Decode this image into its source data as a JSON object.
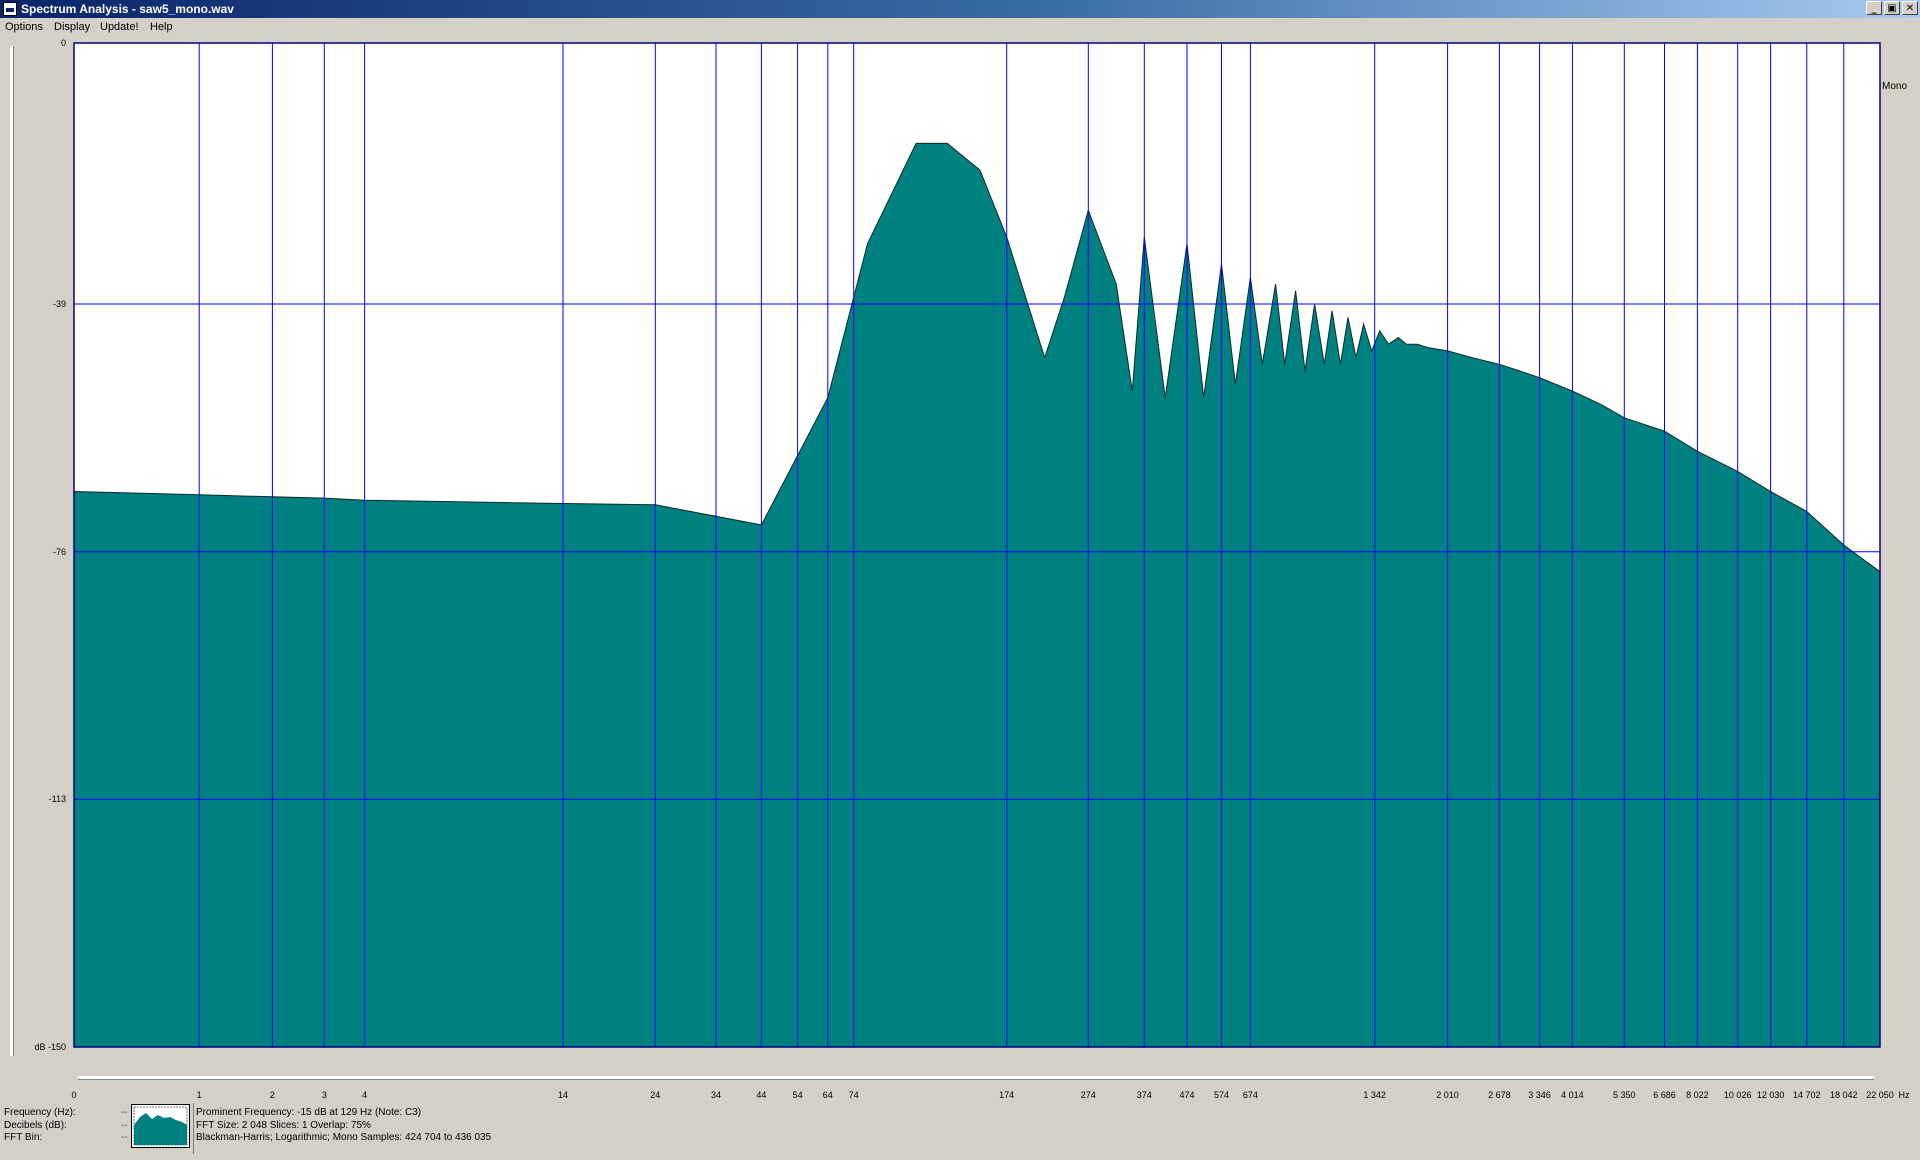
{
  "window": {
    "title": "Spectrum Analysis - saw5_mono.wav",
    "buttons": [
      "_",
      "▣",
      "✕"
    ]
  },
  "menu": [
    {
      "label": "Options"
    },
    {
      "label": "Display"
    },
    {
      "label": "Update!"
    },
    {
      "label": "Help"
    }
  ],
  "channel_label": "Mono",
  "chart_data": {
    "type": "area",
    "title": "",
    "xlabel": "Hz",
    "ylabel": "dB",
    "x_scale": "log",
    "xlim": [
      0,
      22050
    ],
    "ylim": [
      -150,
      0
    ],
    "fill_color": "#008080",
    "grid_color": "#0000ff",
    "grid": true,
    "y_ticks": [
      {
        "value": 0,
        "label": "0"
      },
      {
        "value": -39,
        "label": "-39"
      },
      {
        "value": -76,
        "label": "-76"
      },
      {
        "value": -113,
        "label": "-113"
      },
      {
        "value": -150,
        "label": "dB -150"
      }
    ],
    "x_ticks": [
      {
        "value": 0,
        "label": "0"
      },
      {
        "value": 1,
        "label": "1"
      },
      {
        "value": 2,
        "label": "2"
      },
      {
        "value": 3,
        "label": "3"
      },
      {
        "value": 4,
        "label": "4"
      },
      {
        "value": 14,
        "label": "14"
      },
      {
        "value": 24,
        "label": "24"
      },
      {
        "value": 34,
        "label": "34"
      },
      {
        "value": 44,
        "label": "44"
      },
      {
        "value": 54,
        "label": "54"
      },
      {
        "value": 64,
        "label": "64"
      },
      {
        "value": 74,
        "label": "74"
      },
      {
        "value": 174,
        "label": "174"
      },
      {
        "value": 274,
        "label": "274"
      },
      {
        "value": 374,
        "label": "374"
      },
      {
        "value": 474,
        "label": "474"
      },
      {
        "value": 574,
        "label": "574"
      },
      {
        "value": 674,
        "label": "674"
      },
      {
        "value": 1342,
        "label": "1 342"
      },
      {
        "value": 2010,
        "label": "2 010"
      },
      {
        "value": 2678,
        "label": "2 678"
      },
      {
        "value": 3346,
        "label": "3 346"
      },
      {
        "value": 4014,
        "label": "4 014"
      },
      {
        "value": 5350,
        "label": "5 350"
      },
      {
        "value": 6686,
        "label": "6 686"
      },
      {
        "value": 8022,
        "label": "8 022"
      },
      {
        "value": 10026,
        "label": "10 026"
      },
      {
        "value": 12030,
        "label": "12 030"
      },
      {
        "value": 14702,
        "label": "14 702"
      },
      {
        "value": 18042,
        "label": "18 042"
      },
      {
        "value": 22050,
        "label": "22 050"
      }
    ],
    "x_unit": "Hz",
    "points": [
      [
        0,
        -67
      ],
      [
        1,
        -67.5
      ],
      [
        2,
        -67.8
      ],
      [
        3,
        -68
      ],
      [
        4,
        -68.3
      ],
      [
        14,
        -68.8
      ],
      [
        24,
        -69
      ],
      [
        44,
        -72
      ],
      [
        64,
        -53
      ],
      [
        80,
        -30
      ],
      [
        105,
        -15
      ],
      [
        125,
        -15
      ],
      [
        150,
        -19
      ],
      [
        174,
        -29
      ],
      [
        215,
        -47
      ],
      [
        240,
        -38
      ],
      [
        274,
        -25
      ],
      [
        320,
        -36
      ],
      [
        350,
        -52
      ],
      [
        374,
        -29
      ],
      [
        420,
        -53
      ],
      [
        474,
        -30
      ],
      [
        520,
        -53
      ],
      [
        574,
        -33
      ],
      [
        620,
        -51
      ],
      [
        674,
        -35
      ],
      [
        720,
        -48
      ],
      [
        775,
        -36
      ],
      [
        815,
        -48
      ],
      [
        866,
        -37
      ],
      [
        912,
        -49
      ],
      [
        962,
        -39
      ],
      [
        1015,
        -48
      ],
      [
        1060,
        -40
      ],
      [
        1110,
        -48
      ],
      [
        1158,
        -41
      ],
      [
        1210,
        -47
      ],
      [
        1262,
        -42
      ],
      [
        1320,
        -46
      ],
      [
        1380,
        -43
      ],
      [
        1450,
        -45
      ],
      [
        1530,
        -44
      ],
      [
        1600,
        -45
      ],
      [
        1700,
        -45
      ],
      [
        1800,
        -45.5
      ],
      [
        2010,
        -46
      ],
      [
        2300,
        -47
      ],
      [
        2678,
        -48
      ],
      [
        3000,
        -49
      ],
      [
        3346,
        -50
      ],
      [
        4014,
        -52
      ],
      [
        4700,
        -54
      ],
      [
        5350,
        -56
      ],
      [
        6686,
        -58
      ],
      [
        8022,
        -61
      ],
      [
        10026,
        -64
      ],
      [
        12030,
        -67
      ],
      [
        14702,
        -70
      ],
      [
        18042,
        -75
      ],
      [
        22050,
        -79
      ]
    ]
  },
  "status": {
    "frequency_label": "Frequency (Hz):",
    "frequency_value": "--",
    "decibels_label": "Decibels (dB):",
    "decibels_value": "--",
    "fft_bin_label": "FFT Bin:",
    "fft_bin_value": "--",
    "prominent": "Prominent Frequency: -15 dB at 129 Hz (Note: C3)",
    "fft": "FFT Size: 2 048  Slices: 1  Overlap: 75%",
    "window_info": "Blackman-Harris; Logarithmic; Mono  Samples: 424 704 to 436 035"
  }
}
